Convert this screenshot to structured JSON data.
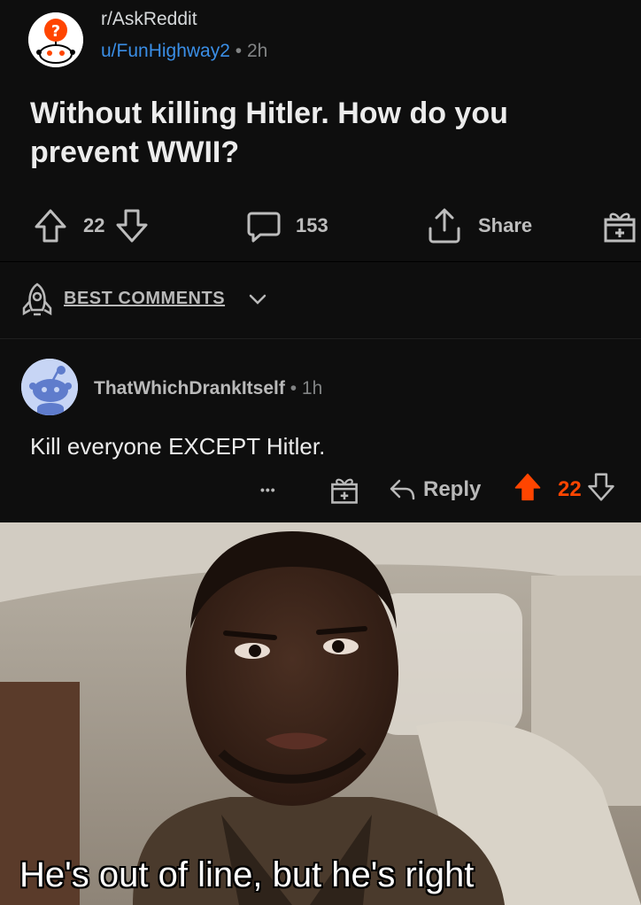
{
  "post": {
    "subreddit": "r/AskReddit",
    "author": "u/FunHighway2",
    "separator": "•",
    "age": "2h",
    "title": "Without killing Hitler. How do you prevent WWII?",
    "vote_count": "22",
    "comment_count": "153",
    "share_label": "Share"
  },
  "sort": {
    "label": "BEST COMMENTS"
  },
  "comment": {
    "author": "ThatWhichDrankItself",
    "separator": "•",
    "age": "1h",
    "body": "Kill everyone EXCEPT Hitler.",
    "more_label": "•••",
    "reply_label": "Reply",
    "vote_count": "22"
  },
  "meme": {
    "caption": "He's out of line, but he's right"
  },
  "colors": {
    "background": "#0e0e0e",
    "username_blue": "#3a8ee6",
    "upvote_orange": "#ff4500",
    "text": "#d7dadc",
    "muted": "#818384"
  }
}
